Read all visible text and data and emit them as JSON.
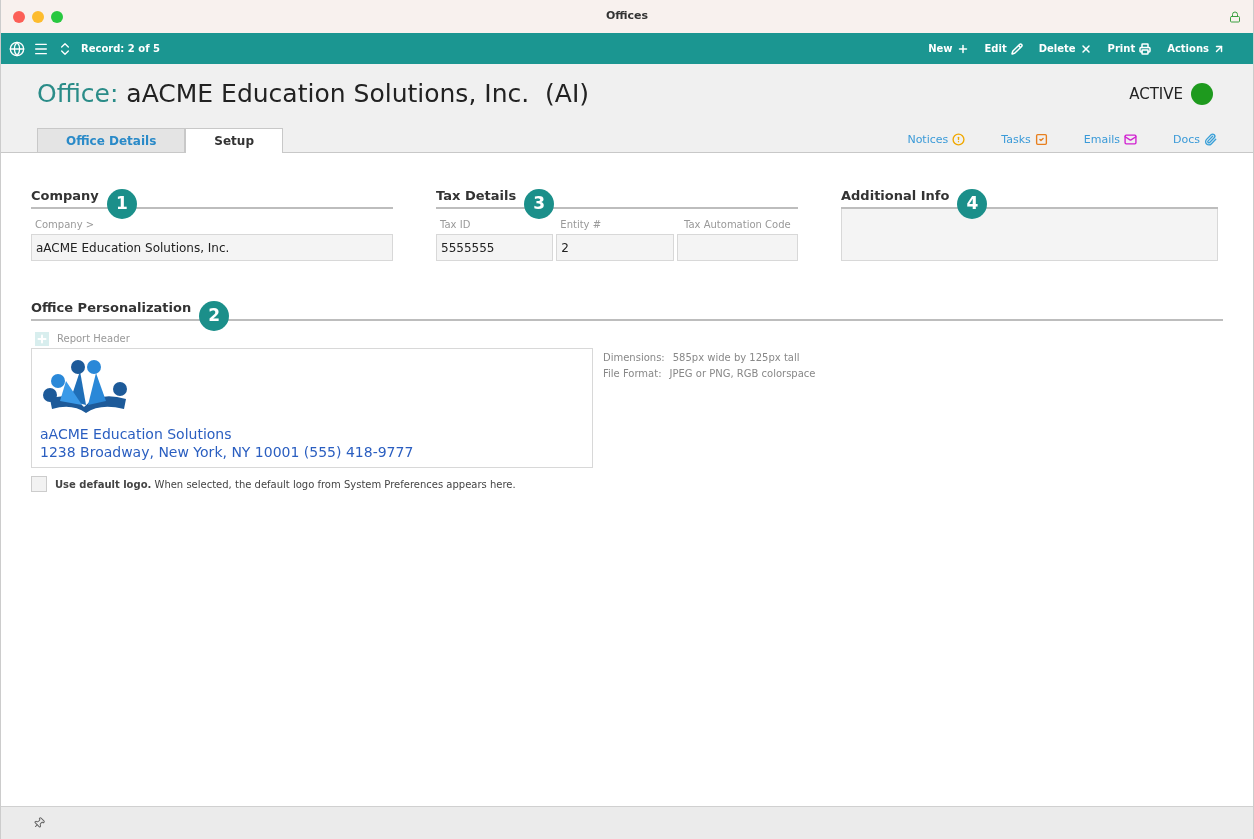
{
  "window": {
    "title": "Offices"
  },
  "toolbar": {
    "record": "Record: 2 of 5",
    "actions": [
      {
        "label": "New",
        "kind": "new"
      },
      {
        "label": "Edit",
        "kind": "edit"
      },
      {
        "label": "Delete",
        "kind": "delete"
      },
      {
        "label": "Print",
        "kind": "print"
      },
      {
        "label": "Actions",
        "kind": "actions"
      }
    ]
  },
  "header": {
    "prefix": "Office:",
    "name": "aACME Education Solutions, Inc.  (AI)",
    "status": "ACTIVE",
    "active": true
  },
  "tabs": [
    {
      "label": "Office Details",
      "selected": false
    },
    {
      "label": "Setup",
      "selected": true
    }
  ],
  "links": [
    {
      "label": "Notices",
      "kind": "notices"
    },
    {
      "label": "Tasks",
      "kind": "tasks"
    },
    {
      "label": "Emails",
      "kind": "emails"
    },
    {
      "label": "Docs",
      "kind": "docs"
    }
  ],
  "company": {
    "title": "Company",
    "badge": "1",
    "label": "Company >",
    "value": "aACME Education Solutions, Inc."
  },
  "tax": {
    "title": "Tax Details",
    "badge": "3",
    "fields": [
      {
        "label": "Tax ID",
        "value": "5555555"
      },
      {
        "label": "Entity #",
        "value": "2"
      },
      {
        "label": "Tax Automation Code"
      }
    ]
  },
  "additional": {
    "title": "Additional Info",
    "badge": "4"
  },
  "personalization": {
    "title": "Office Personalization",
    "badge": "2",
    "header_label": "Report Header",
    "logo_lines": [
      "aACME Education Solutions",
      "1238 Broadway, New York, NY 10001 (555) 418-9777"
    ],
    "specs": [
      {
        "label": "Dimensions:",
        "value": "585px wide by 125px tall"
      },
      {
        "label": "File Format:",
        "value": "JPEG or PNG, RGB colorspace"
      }
    ],
    "default_logo": {
      "checked": false,
      "label": "**Use default logo.** When selected, the default logo from System Preferences appears here."
    }
  }
}
